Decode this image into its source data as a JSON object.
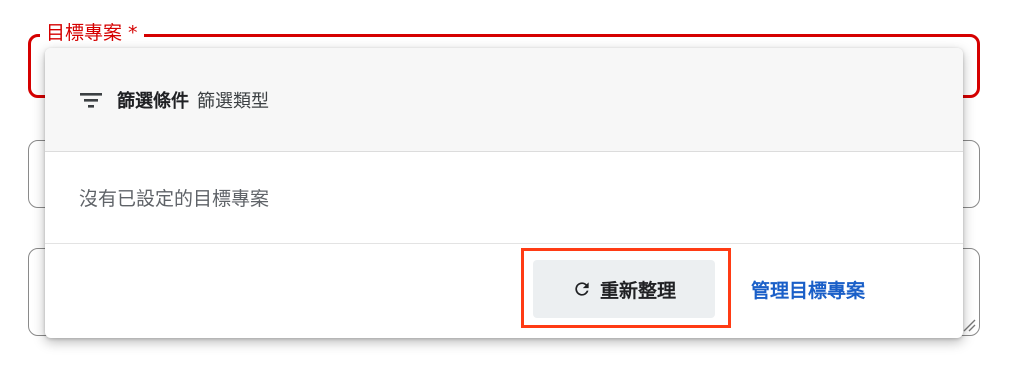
{
  "target_field": {
    "label": "目標專案 *"
  },
  "dropdown": {
    "filter": {
      "icon": "filter-list-icon",
      "title": "篩選條件",
      "type_label": "篩選類型"
    },
    "empty_message": "沒有已設定的目標專案",
    "actions": {
      "refresh_label": "重新整理",
      "refresh_icon": "refresh-icon",
      "manage_label": "管理目標專案"
    }
  },
  "colors": {
    "error": "#d50000",
    "highlight": "#ff3b14",
    "link": "#1a5fc8",
    "button_bg": "#eceff1"
  }
}
